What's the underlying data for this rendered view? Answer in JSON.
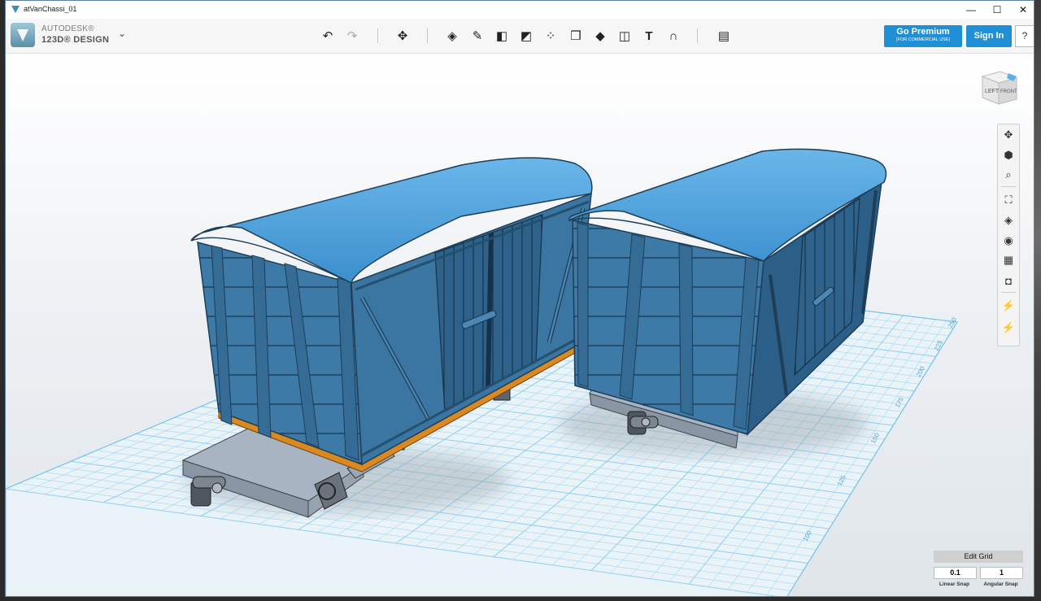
{
  "window": {
    "title": "atVanChassi_01",
    "minimize": "—",
    "maximize": "☐",
    "close": "✕"
  },
  "brand": {
    "line1": "AUTODESK®",
    "line2": "123D® DESIGN",
    "menu_chevron": "⌄"
  },
  "toolbar": {
    "tools": [
      {
        "name": "undo-icon",
        "glyph": "↶"
      },
      {
        "name": "redo-icon",
        "glyph": "↷"
      },
      {
        "name": "transform-icon",
        "glyph": "✥"
      },
      {
        "name": "primitives-icon",
        "glyph": "◈"
      },
      {
        "name": "sketch-icon",
        "glyph": "✎"
      },
      {
        "name": "construct-icon",
        "glyph": "◧"
      },
      {
        "name": "modify-icon",
        "glyph": "◩"
      },
      {
        "name": "pattern-icon",
        "glyph": "⁘"
      },
      {
        "name": "group-icon",
        "glyph": "❒"
      },
      {
        "name": "combine-icon",
        "glyph": "◆"
      },
      {
        "name": "measure-icon",
        "glyph": "◫"
      },
      {
        "name": "text-icon",
        "glyph": "T"
      },
      {
        "name": "snap-icon",
        "glyph": "∩"
      },
      {
        "name": "material-icon",
        "glyph": "▤"
      }
    ],
    "premium_label": "Go Premium",
    "premium_sub": "(FOR COMMERCIAL USE)",
    "signin_label": "Sign In",
    "help_label": "?"
  },
  "viewcube": {
    "left_label": "LEFT",
    "front_label": "FRONT"
  },
  "nav_tools": [
    {
      "name": "pan-icon",
      "glyph": "✥"
    },
    {
      "name": "orbit-icon",
      "glyph": "⬢"
    },
    {
      "name": "zoom-icon",
      "glyph": "⌕"
    },
    {
      "name": "fit-icon",
      "glyph": "⛶"
    },
    {
      "name": "view-icon",
      "glyph": "◈"
    },
    {
      "name": "visibility-icon",
      "glyph": "◉"
    },
    {
      "name": "materials-icon",
      "glyph": "▦"
    },
    {
      "name": "screenshot-icon",
      "glyph": "◘"
    },
    {
      "name": "select-hide-icon",
      "glyph": "⚡"
    },
    {
      "name": "show-all-icon",
      "glyph": "⚡"
    }
  ],
  "grid": {
    "edit_label": "Edit Grid",
    "linear_value": "0.1",
    "angular_value": "1",
    "linear_label": "Linear Snap",
    "angular_label": "Angular Snap",
    "ruler_labels": [
      "50",
      "75",
      "100",
      "125",
      "150",
      "175",
      "200",
      "225",
      "250"
    ]
  },
  "colors": {
    "accent": "#1f8fd6",
    "wagon_body": "#3f79a6",
    "wagon_roof": "#57a7de",
    "wagon_trim": "#d9891f",
    "chassis": "#a9b3bf",
    "grid_line": "#7fc9ee"
  }
}
